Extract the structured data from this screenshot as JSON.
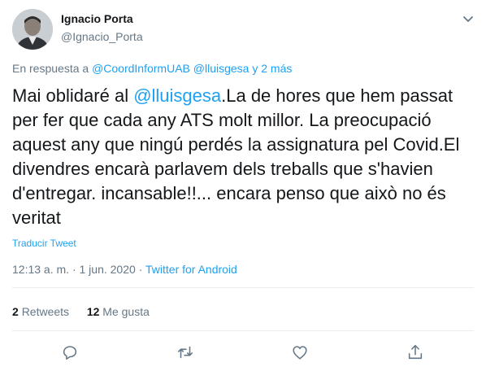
{
  "author": {
    "name": "Ignacio Porta",
    "handle": "@Ignacio_Porta"
  },
  "reply_to": {
    "prefix": "En respuesta a",
    "mention_1": "@CoordInformUAB",
    "mention_2": "@lluisgesa",
    "suffix": "y 2 más"
  },
  "tweet": {
    "text_before": "Mai oblidaré al ",
    "mention": "@lluisgesa",
    "text_after": ".La de hores que hem passat per fer que cada any ATS molt millor. La preocupació aquest any que ningú perdés la assignatura pel Covid.El divendres encarà parlavem dels treballs que s'havien d'entregar. incansable!!... encara penso que això no és veritat"
  },
  "translate_label": "Traducir Tweet",
  "meta": {
    "time": "12:13 a. m.",
    "date": "1 jun. 2020",
    "source": "Twitter for Android",
    "separator": "·"
  },
  "stats": {
    "retweets_count": "2",
    "retweets_label": "Retweets",
    "likes_count": "12",
    "likes_label": "Me gusta"
  },
  "actions": [
    "reply-icon",
    "retweet-icon",
    "like-icon",
    "share-icon"
  ],
  "colors": {
    "accent": "#1da1f2",
    "text": "#14171a",
    "secondary": "#657786",
    "divider": "#e6ecf0"
  }
}
